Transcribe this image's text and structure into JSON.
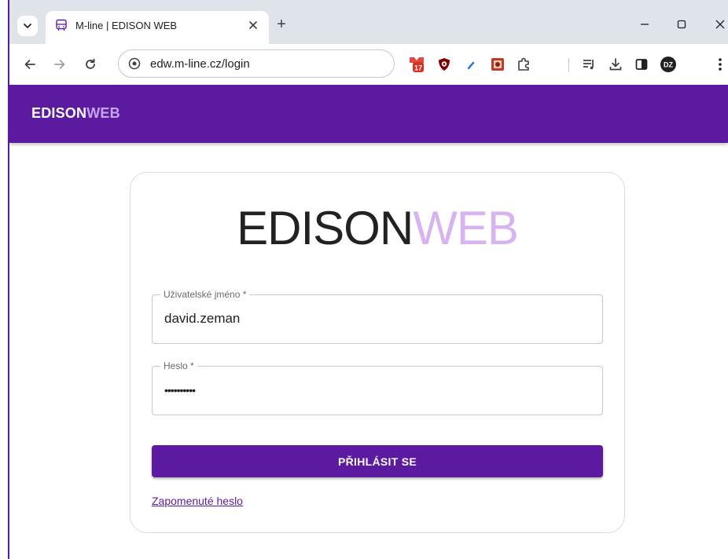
{
  "browser": {
    "tab": {
      "title": "M-line | EDISON WEB",
      "close_glyph": "✕",
      "favicon": "bus-icon"
    },
    "tab_dropdown_glyph": "⌄",
    "new_tab_glyph": "+",
    "window_controls": {
      "minimize": "—",
      "maximize": "☐",
      "close": "✕"
    },
    "nav": {
      "back": "←",
      "forward": "→",
      "reload": "↻"
    },
    "address": {
      "url": "edw.m-line.cz/login"
    },
    "extensions": {
      "calendar_badge": "17",
      "profile_initials": "DZ"
    },
    "colors": {
      "tabstrip": "#dfe3ea",
      "brand": "#5c1aa0"
    }
  },
  "app": {
    "header": {
      "brand_main": "EDISON",
      "brand_accent": "WEB"
    },
    "login": {
      "logo_main": "EDISON",
      "logo_accent": "WEB",
      "username": {
        "label": "Uživatelské jméno *",
        "value": "david.zeman"
      },
      "password": {
        "label": "Heslo *",
        "value": "••••••••••"
      },
      "submit_label": "PŘIHLÁSIT SE",
      "forgot_label": "Zapomenuté heslo"
    },
    "colors": {
      "primary": "#5c1aa0",
      "accent_light": "#d7b3f2"
    }
  }
}
